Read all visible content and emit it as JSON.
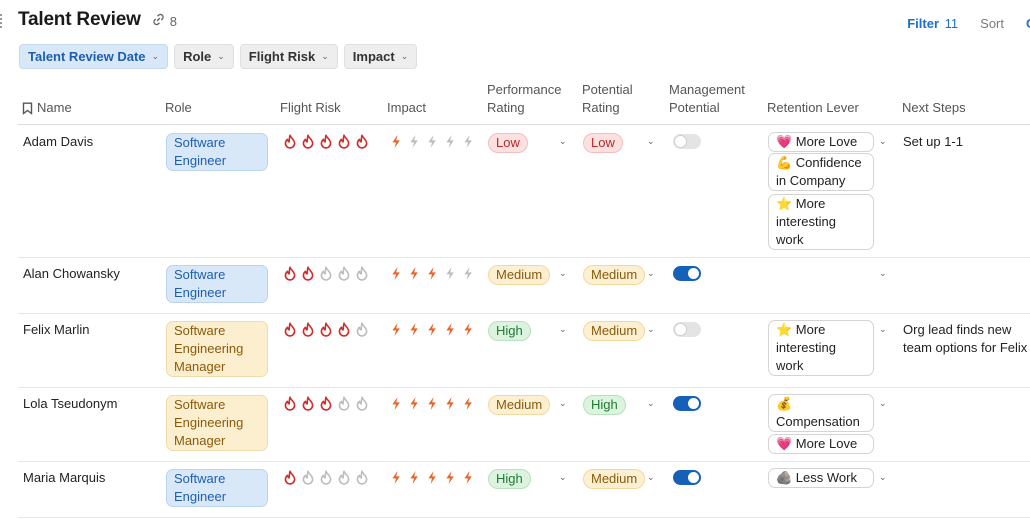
{
  "header": {
    "title": "Talent Review",
    "link_count": "8"
  },
  "toolbar": {
    "filter_label": "Filter",
    "filter_count": "11",
    "sort_label": "Sort",
    "truncated_label": "C"
  },
  "chips": [
    {
      "label": "Talent Review Date",
      "active": true
    },
    {
      "label": "Role",
      "active": false
    },
    {
      "label": "Flight Risk",
      "active": false
    },
    {
      "label": "Impact",
      "active": false
    }
  ],
  "columns": {
    "name": "Name",
    "role": "Role",
    "flight_risk": "Flight Risk",
    "impact": "Impact",
    "performance": "Performance Rating",
    "potential": "Potential Rating",
    "management": "Management Potential",
    "retention": "Retention Lever",
    "next_steps": "Next Steps"
  },
  "rows": [
    {
      "name": "Adam Davis",
      "role": "Software Engineer",
      "flight_risk": 5,
      "impact": 1,
      "performance": "Low",
      "potential": "Low",
      "management_potential": false,
      "retention": [
        "💗 More Love",
        "💪 Confidence in Company",
        "⭐ More interesting work"
      ],
      "next_steps": "Set up 1-1"
    },
    {
      "name": "Alan Chowansky",
      "role": "Software Engineer",
      "flight_risk": 2,
      "impact": 3,
      "performance": "Medium",
      "potential": "Medium",
      "management_potential": true,
      "retention": [],
      "next_steps": ""
    },
    {
      "name": "Felix Marlin",
      "role": "Software Engineering Manager",
      "flight_risk": 4,
      "impact": 5,
      "performance": "High",
      "potential": "Medium",
      "management_potential": false,
      "retention": [
        "⭐ More interesting work"
      ],
      "next_steps": "Org lead finds new team options for Felix"
    },
    {
      "name": "Lola Tseudonym",
      "role": "Software Engineering Manager",
      "flight_risk": 3,
      "impact": 5,
      "performance": "Medium",
      "potential": "High",
      "management_potential": true,
      "retention": [
        "💰 Compensation",
        "💗 More Love"
      ],
      "next_steps": ""
    },
    {
      "name": "Maria Marquis",
      "role": "Software Engineer",
      "flight_risk": 1,
      "impact": 5,
      "performance": "High",
      "potential": "Medium",
      "management_potential": true,
      "retention": [
        "🪨 Less Work"
      ],
      "next_steps": ""
    }
  ],
  "colors": {
    "accent": "#1d6fd1",
    "fire": "#d42a2a",
    "bolt": "#e8652a",
    "inactive": "#bdbdbd"
  },
  "icons": {
    "flight_risk": "fire-icon",
    "impact": "lightning-icon",
    "link": "link-icon",
    "name": "bookmark-icon"
  }
}
